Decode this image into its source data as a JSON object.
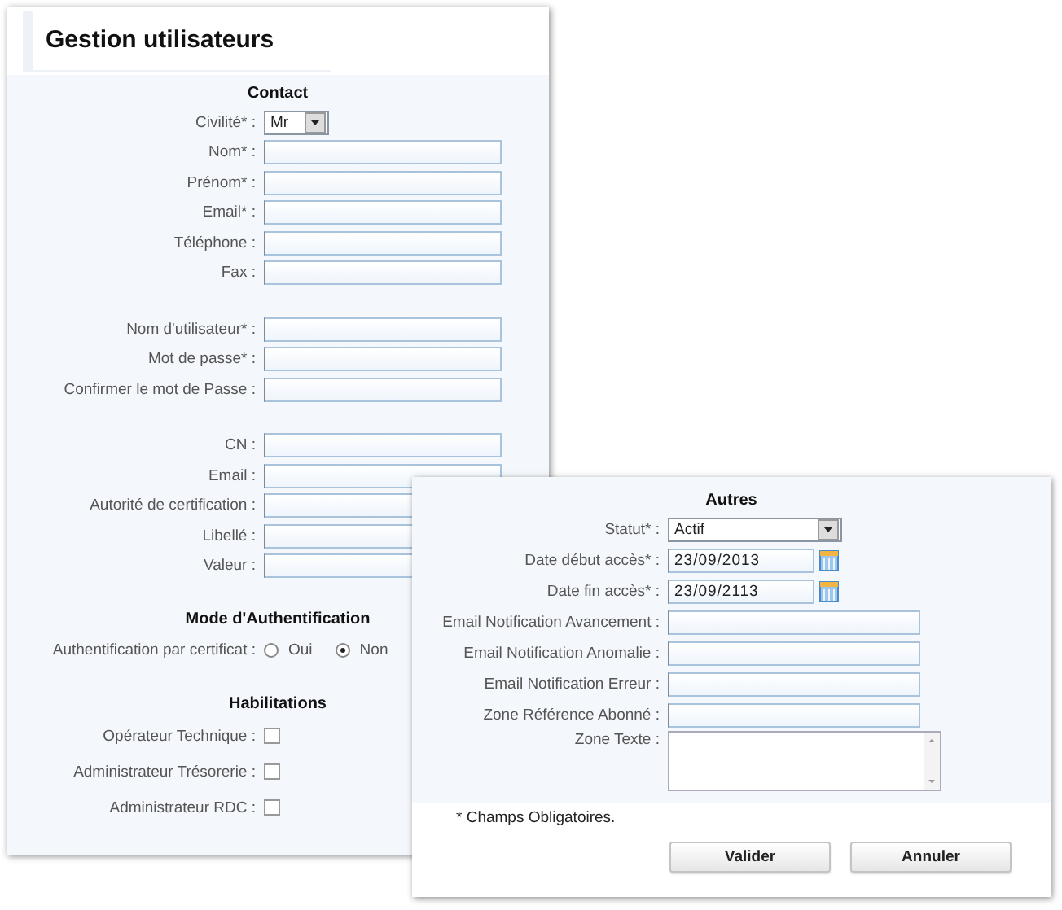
{
  "title": "Gestion utilisateurs",
  "left_form": {
    "sections": [
      {
        "heading": "Contact",
        "groups": [
          [
            {
              "kind": "select",
              "label": "Civilité* :",
              "value": "Mr"
            },
            {
              "kind": "text",
              "label": "Nom* :"
            },
            {
              "kind": "text",
              "label": "Prénom* :"
            },
            {
              "kind": "text",
              "label": "Email* :"
            },
            {
              "kind": "text",
              "label": "Téléphone :"
            },
            {
              "kind": "text",
              "label": "Fax :"
            }
          ],
          [
            {
              "kind": "text",
              "label": "Nom d'utilisateur* :"
            },
            {
              "kind": "text",
              "label": "Mot de passe* :"
            },
            {
              "kind": "text",
              "label": "Confirmer le mot de Passe :"
            }
          ],
          [
            {
              "kind": "text",
              "label": "CN :"
            },
            {
              "kind": "text",
              "label": "Email :"
            },
            {
              "kind": "text",
              "label": "Autorité de certification :"
            },
            {
              "kind": "text",
              "label": "Libellé :"
            },
            {
              "kind": "text",
              "label": "Valeur :"
            }
          ]
        ]
      },
      {
        "heading": "Mode d'Authentification",
        "groups": [
          [
            {
              "kind": "radio",
              "label": "Authentification par certificat :",
              "options": [
                {
                  "label": "Oui",
                  "selected": false
                },
                {
                  "label": "Non",
                  "selected": true
                }
              ]
            }
          ]
        ]
      },
      {
        "heading": "Habilitations",
        "groups": [
          [
            {
              "kind": "checkbox",
              "label": "Opérateur Technique :",
              "checked": false
            },
            {
              "kind": "checkbox",
              "label": "Administrateur Trésorerie :",
              "checked": false
            },
            {
              "kind": "checkbox",
              "label": "Administrateur RDC :",
              "checked": false
            }
          ]
        ]
      }
    ]
  },
  "dialog": {
    "heading": "Autres",
    "rows": [
      {
        "kind": "select",
        "label": "Statut* :",
        "value": "Actif"
      },
      {
        "kind": "date",
        "label": "Date début accès* :",
        "value": "23/09/2013"
      },
      {
        "kind": "date",
        "label": "Date fin accès* :",
        "value": "23/09/2113"
      },
      {
        "kind": "text",
        "label": "Email Notification Avancement :"
      },
      {
        "kind": "text",
        "label": "Email Notification Anomalie :"
      },
      {
        "kind": "text",
        "label": "Email Notification Erreur :"
      },
      {
        "kind": "text",
        "label": "Zone Référence Abonné :"
      },
      {
        "kind": "textarea",
        "label": "Zone Texte :"
      }
    ],
    "note": "* Champs Obligatoires.",
    "buttons": [
      "Valider",
      "Annuler"
    ]
  }
}
